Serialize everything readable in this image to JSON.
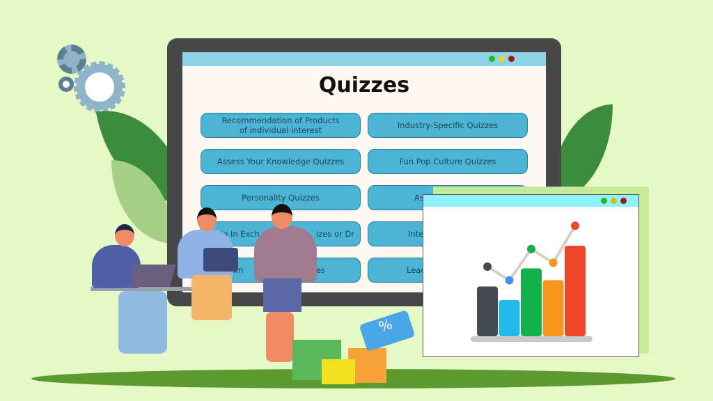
{
  "screen": {
    "title": "Quizzes",
    "buttons": [
      {
        "label": "Recommendation of Products\nof individual interest"
      },
      {
        "label": "Industry-Specific Quizzes"
      },
      {
        "label": "Assess Your Knowledge Quizzes"
      },
      {
        "label": "Fun Pop Culture Quizzes"
      },
      {
        "label": "Personality Quizzes"
      },
      {
        "label": "As"
      },
      {
        "label": "Trivia In Exch"
      },
      {
        "label": "Inte"
      },
      {
        "label": "stom"
      },
      {
        "label": "Lead"
      }
    ],
    "partial_labels": {
      "trivia_tail": "izes or Dr",
      "custom_tail": "k Quizzes"
    },
    "window_dots": [
      "#22bb22",
      "#f2d21a",
      "#a01818"
    ]
  },
  "chart_window": {
    "bars": [
      {
        "color": "#444b55",
        "value": 55
      },
      {
        "color": "#22b8ea",
        "value": 40
      },
      {
        "color": "#12b04a",
        "value": 75
      },
      {
        "color": "#f7941d",
        "value": 62
      },
      {
        "color": "#f0462a",
        "value": 100
      }
    ],
    "line_colors": [
      "#444b55",
      "#4a8ef0",
      "#12b04a",
      "#f7941d",
      "#f0462a"
    ],
    "line_values": [
      50,
      36,
      68,
      54,
      92
    ],
    "window_dots": [
      "#22bb22",
      "#c8c020",
      "#a01818"
    ]
  },
  "colors": {
    "background": "#e5f8c6",
    "button": "#4cb5d6",
    "monitor": "#474747"
  }
}
